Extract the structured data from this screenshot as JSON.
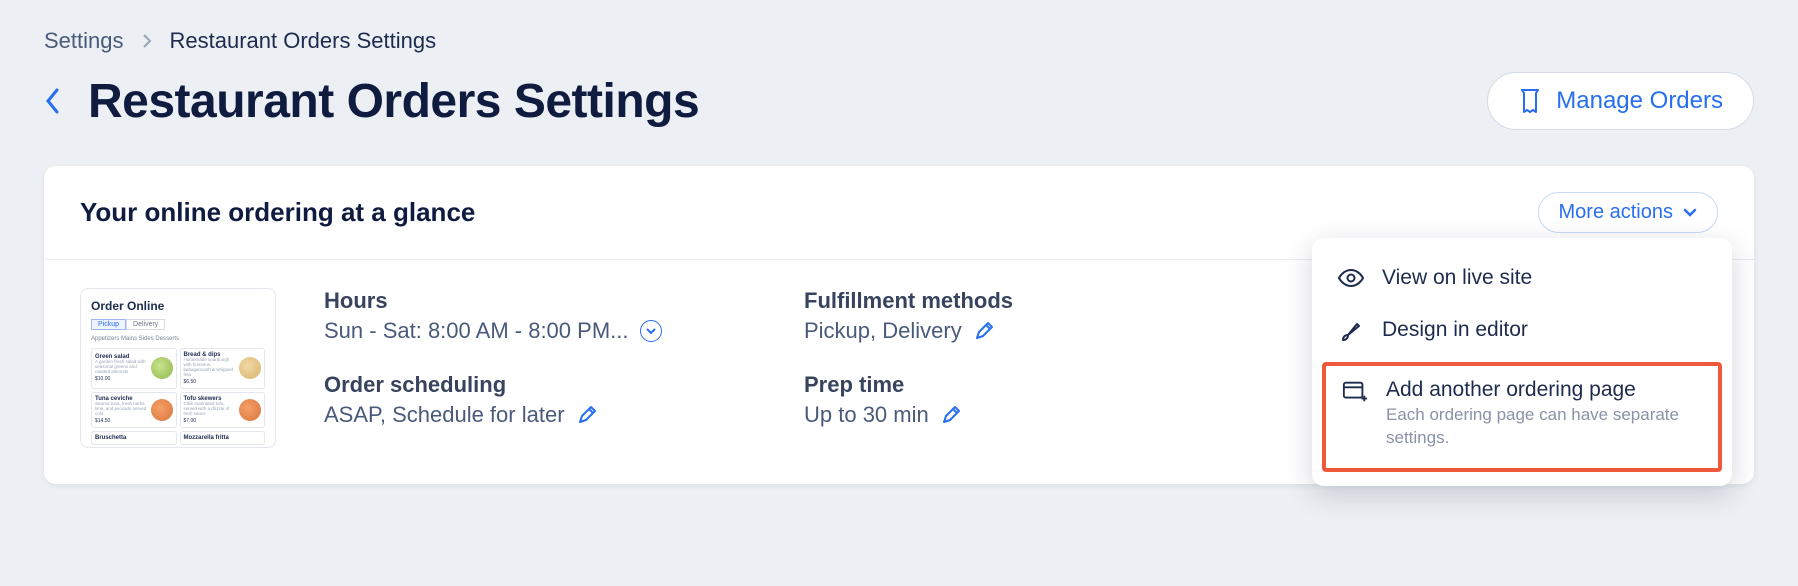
{
  "breadcrumb": {
    "root": "Settings",
    "current": "Restaurant Orders Settings"
  },
  "page": {
    "title": "Restaurant Orders Settings",
    "manage_button": "Manage Orders"
  },
  "card": {
    "title": "Your online ordering at a glance",
    "more_actions": "More actions"
  },
  "thumbnail": {
    "heading": "Order Online",
    "tabs": [
      "Pickup",
      "Delivery"
    ],
    "categories": "Appetizers   Mains   Sides   Desserts",
    "items": [
      {
        "name": "Green salad",
        "desc": "A garden fresh salad with seasonal greens and roasted almonds",
        "price": "$10.00"
      },
      {
        "name": "Bread & dips",
        "desc": "Homemade sourdough with hummus, babaganoush & whipped feta",
        "price": "$6.50"
      },
      {
        "name": "Tuna ceviche",
        "desc": "Seared tuna, fresh herbs, lime, and avocado served cold",
        "price": "$14.50"
      },
      {
        "name": "Tofu skewers",
        "desc": "Chilli marinated tofu, served with a drizzle of herb sauce",
        "price": "$7.00"
      },
      {
        "name": "Bruschetta",
        "desc": "",
        "price": ""
      },
      {
        "name": "Mozzarella fritta",
        "desc": "",
        "price": ""
      }
    ]
  },
  "stats": {
    "hours": {
      "label": "Hours",
      "value": "Sun - Sat: 8:00 AM - 8:00 PM..."
    },
    "scheduling": {
      "label": "Order scheduling",
      "value": "ASAP, Schedule for later"
    },
    "fulfillment": {
      "label": "Fulfillment methods",
      "value": "Pickup, Delivery"
    },
    "prep": {
      "label": "Prep time",
      "value": "Up to 30 min"
    }
  },
  "menu": {
    "view": "View on live site",
    "design": "Design in editor",
    "add": "Add another ordering page",
    "add_sub": "Each ordering page can have separate settings."
  }
}
